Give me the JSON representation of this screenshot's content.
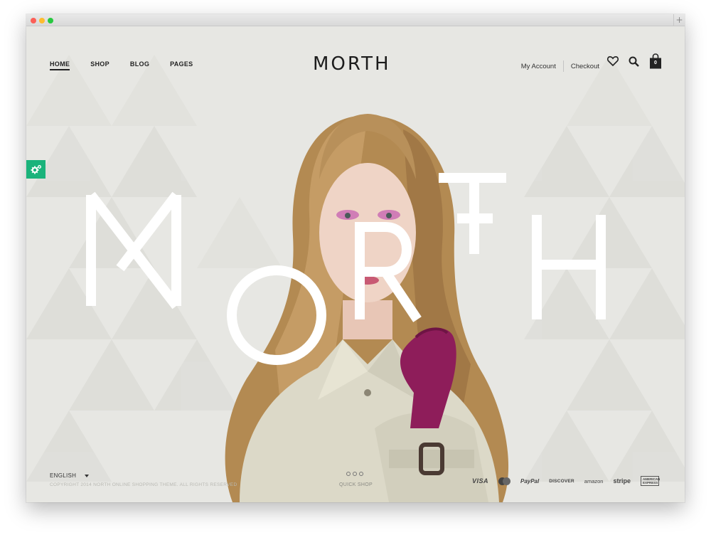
{
  "brand": {
    "logo_text": "MORTH"
  },
  "nav": {
    "left": [
      {
        "label": "HOME",
        "active": true
      },
      {
        "label": "SHOP",
        "active": false
      },
      {
        "label": "BLOG",
        "active": false
      },
      {
        "label": "PAGES",
        "active": false
      }
    ],
    "account_label": "My Account",
    "checkout_label": "Checkout",
    "cart_count": "0"
  },
  "hero": {
    "letters": [
      "M",
      "O",
      "R",
      "T",
      "H"
    ]
  },
  "footer": {
    "language": "ENGLISH",
    "copyright": "COPYRIGHT 2014 NORTH ONLINE SHOPPING THEME. ALL RIGHTS RESERVED",
    "quick_shop": "QUICK SHOP",
    "payments": {
      "visa": "VISA",
      "paypal": "PayPal",
      "discover": "DISCOVER",
      "amazon": "amazon",
      "stripe": "stripe",
      "amex": "AMERICAN EXPRESS"
    }
  },
  "colors": {
    "background": "#e7e7e3",
    "accent_green": "#1ab37b",
    "glove_magenta": "#8e1d5a",
    "text_dark": "#222222"
  },
  "icons": {
    "wishlist": "heart-icon",
    "search": "search-icon",
    "cart": "shopping-bag-icon",
    "settings": "gears-icon"
  }
}
